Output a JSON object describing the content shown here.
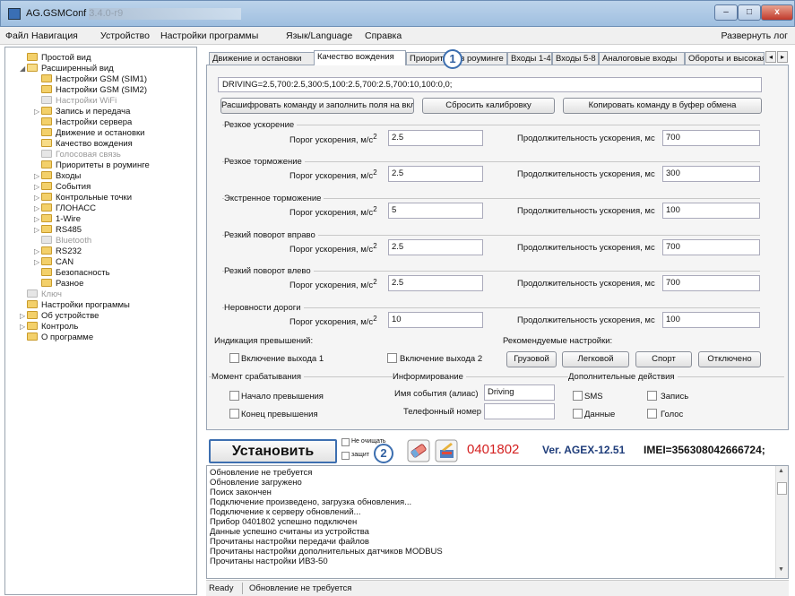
{
  "window": {
    "title": "AG.GSMConf 3.4.0-r9",
    "min_glyph": "–",
    "max_glyph": "□",
    "close_glyph": "x"
  },
  "menu": {
    "items": [
      "Файл",
      "Навигация",
      "Устройство",
      "Настройки программы",
      "Язык/Language",
      "Справка"
    ],
    "right": "Развернуть лог"
  },
  "tree": [
    {
      "label": "Простой вид",
      "arrow": ""
    },
    {
      "label": "Расширенный вид",
      "arrow": "◢"
    },
    {
      "label": "Настройки GSM (SIM1)",
      "arrow": ""
    },
    {
      "label": "Настройки GSM (SIM2)",
      "arrow": ""
    },
    {
      "label": "Настройки WiFi",
      "arrow": ""
    },
    {
      "label": "Запись и передача",
      "arrow": "▷"
    },
    {
      "label": "Настройки сервера",
      "arrow": ""
    },
    {
      "label": "Движение и остановки",
      "arrow": ""
    },
    {
      "label": "Качество вождения",
      "arrow": ""
    },
    {
      "label": "Голосовая связь",
      "arrow": ""
    },
    {
      "label": "Приоритеты в роуминге",
      "arrow": ""
    },
    {
      "label": "Входы",
      "arrow": "▷"
    },
    {
      "label": "События",
      "arrow": "▷"
    },
    {
      "label": "Контрольные точки",
      "arrow": "▷"
    },
    {
      "label": "ГЛОНАСС",
      "arrow": "▷"
    },
    {
      "label": "1-Wire",
      "arrow": "▷"
    },
    {
      "label": "RS485",
      "arrow": "▷"
    },
    {
      "label": "Bluetooth",
      "arrow": ""
    },
    {
      "label": "RS232",
      "arrow": "▷"
    },
    {
      "label": "CAN",
      "arrow": "▷"
    },
    {
      "label": "Безопасность",
      "arrow": ""
    },
    {
      "label": "Разное",
      "arrow": ""
    },
    {
      "label": "Ключ",
      "arrow": ""
    },
    {
      "label": "Настройки программы",
      "arrow": ""
    },
    {
      "label": "Об устройстве",
      "arrow": "▷"
    },
    {
      "label": "Контроль",
      "arrow": "▷"
    },
    {
      "label": "О программе",
      "arrow": ""
    }
  ],
  "tabs": [
    "Движение и остановки",
    "Качество вождения",
    "Приоритеты в роуминге",
    "Входы 1-4",
    "Входы 5-8",
    "Аналоговые входы",
    "Обороты и высокая",
    "◂",
    "▸"
  ],
  "command_line": "DRIVING=2.5,700:2.5,300:5,100:2.5,700:2.5,700:10,100:0,0;",
  "buttons": {
    "decode": "Расшифровать команду и заполнить поля на вкладке",
    "reset": "Сбросить калибровку",
    "copy": "Копировать команду в буфер обмена"
  },
  "sections": [
    {
      "title": "Резкое ускорение",
      "threshold_label": "Порог ускорения, м/с",
      "sup": "2",
      "threshold": "2.5",
      "duration_label": "Продолжительность ускорения, мс",
      "duration": "700"
    },
    {
      "title": "Резкое торможение",
      "threshold_label": "Порог ускорения, м/с",
      "sup": "2",
      "threshold": "2.5",
      "duration_label": "Продолжительность ускорения, мс",
      "duration": "300"
    },
    {
      "title": "Экстренное торможение",
      "threshold_label": "Порог ускорения, м/с",
      "sup": "2",
      "threshold": "5",
      "duration_label": "Продолжительность ускорения, мс",
      "duration": "100"
    },
    {
      "title": "Резкий поворот вправо",
      "threshold_label": "Порог ускорения, м/с",
      "sup": "2",
      "threshold": "2.5",
      "duration_label": "Продолжительность ускорения, мс",
      "duration": "700"
    },
    {
      "title": "Резкий поворот влево",
      "threshold_label": "Порог ускорения, м/с",
      "sup": "2",
      "threshold": "2.5",
      "duration_label": "Продолжительность ускорения, мс",
      "duration": "700"
    },
    {
      "title": "Неровности дороги",
      "threshold_label": "Порог ускорения, м/с",
      "sup": "2",
      "threshold": "10",
      "duration_label": "Продолжительность ускорения, мс",
      "duration": "100"
    }
  ],
  "indication": {
    "title": "Индикация превышений:",
    "out1": "Включение выхода 1",
    "out2": "Включение выхода 2"
  },
  "recommended": {
    "title": "Рекомендуемые настройки:",
    "buttons": [
      "Грузовой",
      "Легковой",
      "Спорт",
      "Отключено"
    ]
  },
  "trigger": {
    "title": "Момент срабатывания",
    "start": "Начало превышения",
    "end": "Конец превышения"
  },
  "inform": {
    "title": "Информирование",
    "event_label": "Имя события (алиас)",
    "event_value": "Driving",
    "phone_label": "Телефонный номер",
    "phone_value": ""
  },
  "extra": {
    "title": "Дополнительные действия",
    "sms": "SMS",
    "record": "Запись",
    "data": "Данные",
    "voice": "Голос"
  },
  "bottom": {
    "install": "Установить",
    "small_cb1": "Не очищать",
    "small_cb2": "защит",
    "serial": "0401802",
    "version": "Ver. AGEX-12.51",
    "imei": "IMEI=356308042666724;"
  },
  "log": [
    "Обновление не требуется",
    "Обновление загружено",
    "Поиск закончен",
    "Подключение произведено, загрузка обновления...",
    "Подключение к серверу обновлений...",
    "Прибор 0401802 успешно подключен",
    "Данные успешно считаны из устройства",
    "Прочитаны настройки передачи файлов",
    "Прочитаны настройки дополнительных датчиков MODBUS",
    "Прочитаны настройки ИВЗ-50"
  ],
  "status": {
    "left": "Ready",
    "right": "Обновление не требуется"
  },
  "callouts": [
    "1",
    "2"
  ],
  "colors": {
    "accent": "#3d6fb0",
    "serial_red": "#d42020",
    "version_blue": "#1f3d7a"
  }
}
